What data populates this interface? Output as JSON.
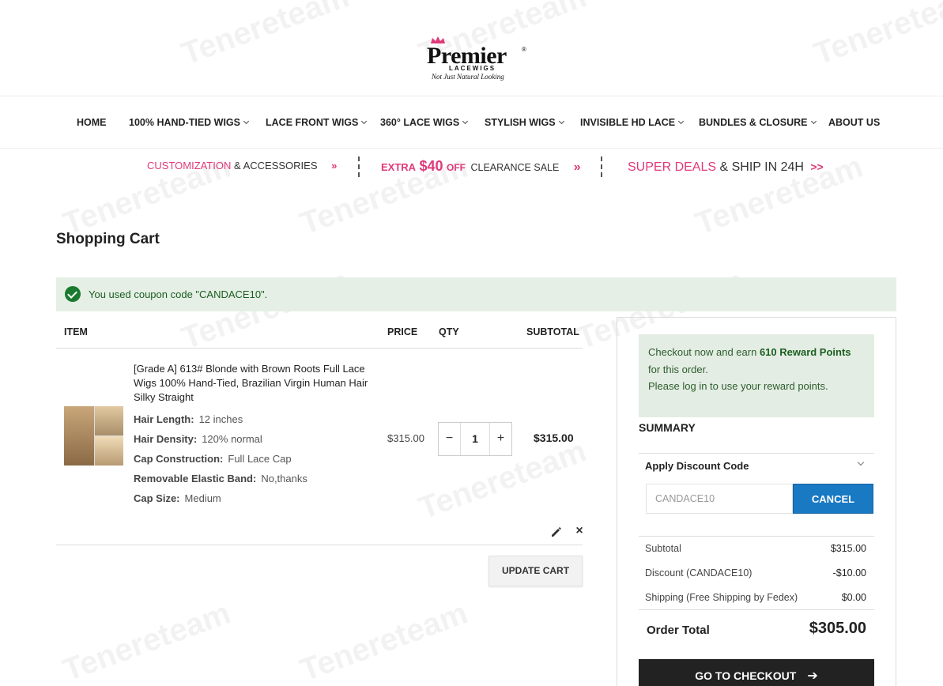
{
  "brand": {
    "name": "Premier",
    "line": "LACEWIGS",
    "tagline": "Not Just Natural Looking",
    "registered": "®"
  },
  "nav": {
    "items": [
      {
        "label": "HOME",
        "dropdown": false
      },
      {
        "label": "100% HAND-TIED WIGS",
        "dropdown": true
      },
      {
        "label": "LACE FRONT WIGS",
        "dropdown": true
      },
      {
        "label": "360° LACE WIGS",
        "dropdown": true
      },
      {
        "label": "STYLISH WIGS",
        "dropdown": true
      },
      {
        "label": "INVISIBLE HD LACE",
        "dropdown": true
      },
      {
        "label": "BUNDLES & CLOSURE",
        "dropdown": true
      },
      {
        "label": "ABOUT US",
        "dropdown": false
      }
    ]
  },
  "promo": {
    "p1_pink": "CUSTOMIZATION",
    "p1_rest": "& ACCESSORIES",
    "p1_arrow": "»",
    "p2_pink_a": "EXTRA",
    "p2_pink_b": "$40",
    "p2_pink_c": "OFF",
    "p2_rest": "CLEARANCE SALE",
    "p2_arrow": "»",
    "p3_pink": "SUPER DEALS",
    "p3_rest": "& SHIP IN 24H",
    "p3_arrow": ">>"
  },
  "page": {
    "title": "Shopping Cart"
  },
  "message": {
    "text": "You used coupon code \"CANDACE10\"."
  },
  "cart": {
    "headers": {
      "item": "ITEM",
      "price": "PRICE",
      "qty": "QTY",
      "subtotal": "SUBTOTAL"
    },
    "item": {
      "name": "[Grade A] 613# Blonde with Brown Roots Full Lace Wigs 100% Hand-Tied, Brazilian Virgin Human Hair Silky Straight",
      "options": [
        {
          "label": "Hair Length:",
          "value": "12 inches"
        },
        {
          "label": "Hair Density:",
          "value": "120% normal"
        },
        {
          "label": "Cap Construction:",
          "value": "Full Lace Cap"
        },
        {
          "label": "Removable Elastic Band:",
          "value": "No,thanks"
        },
        {
          "label": "Cap Size:",
          "value": "Medium"
        }
      ],
      "price": "$315.00",
      "qty": "1",
      "minus": "−",
      "plus": "+",
      "subtotal": "$315.00",
      "remove": "×"
    },
    "update_label": "UPDATE CART"
  },
  "sidebar": {
    "reward_pre": "Checkout now and earn ",
    "reward_points": "610 Reward Points",
    "reward_line2": "for this order.",
    "reward_line3": "Please log in to use your reward points.",
    "summary_title": "SUMMARY",
    "discount_heading": "Apply Discount Code",
    "discount_value": "CANDACE10",
    "cancel_label": "CANCEL",
    "rows": [
      {
        "label": "Subtotal",
        "value": "$315.00"
      },
      {
        "label": "Discount (CANDACE10)",
        "value": "-$10.00"
      },
      {
        "label": "Shipping (Free Shipping by Fedex)",
        "value": "$0.00"
      }
    ],
    "order_total_label": "Order Total",
    "order_total_value": "$305.00",
    "checkout_label": "GO TO CHECKOUT",
    "checkout_arrow": "➔"
  },
  "watermark": "Tenereteam",
  "colors": {
    "accent_pink": "#e0397a",
    "success_bg": "#e5efe5",
    "primary_blue": "#1979c3",
    "checkout_bg": "#222222"
  }
}
